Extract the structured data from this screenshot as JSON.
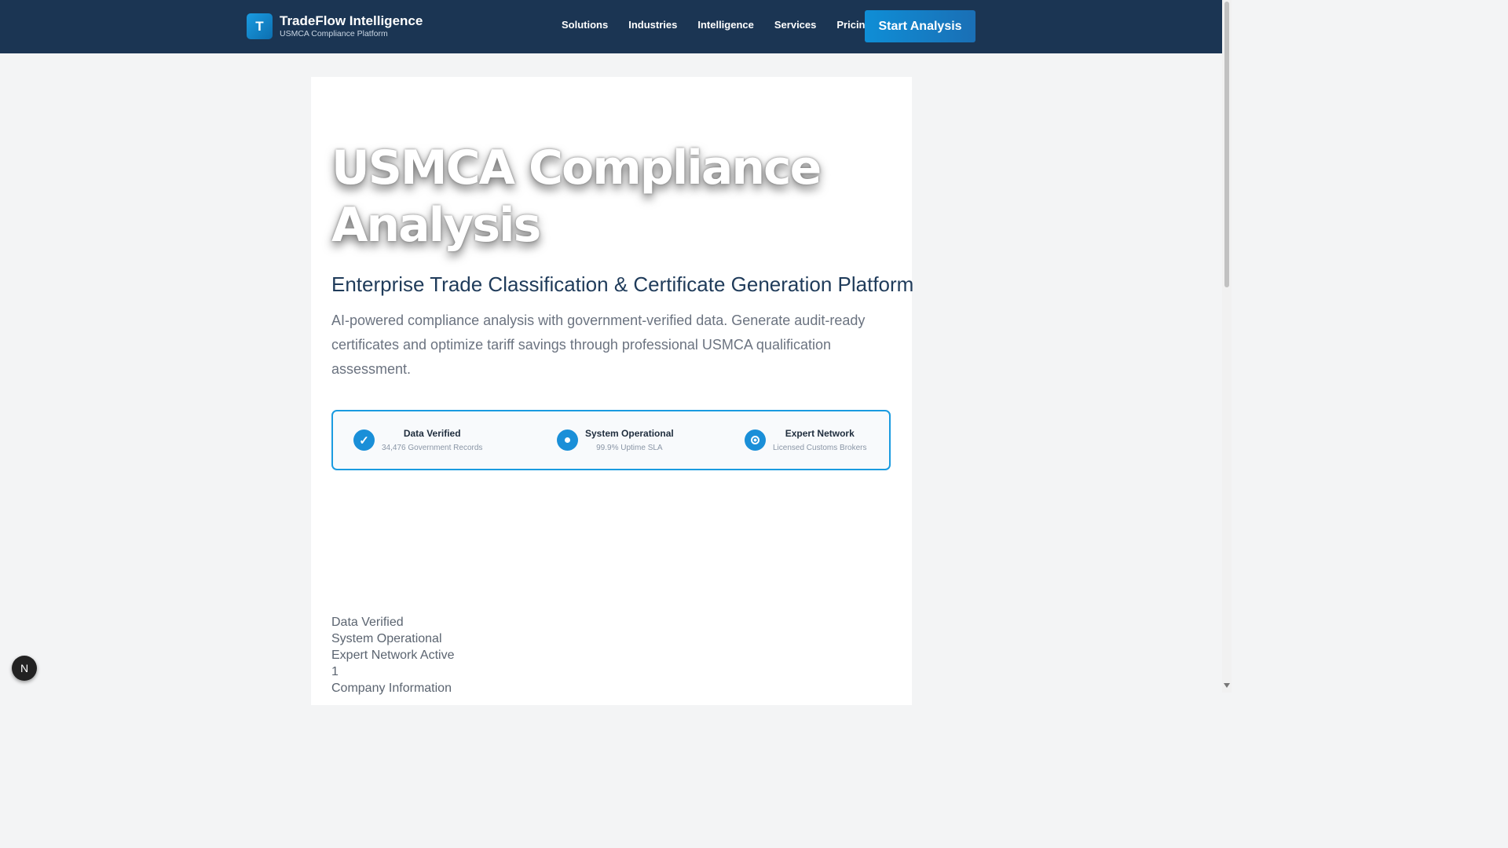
{
  "header": {
    "logo_letter": "T",
    "brand_name": "TradeFlow Intelligence",
    "tagline": "USMCA Compliance Platform",
    "nav": [
      "Solutions",
      "Industries",
      "Intelligence",
      "Services",
      "Pricing"
    ],
    "cta_label": "Start Analysis"
  },
  "hero": {
    "title": "USMCA Compliance Analysis",
    "subtitle": "Enterprise Trade Classification & Certificate Generation Platform",
    "description": "AI-powered compliance analysis with government-verified data. Generate audit-ready certificates and optimize tariff savings through professional USMCA qualification assessment."
  },
  "status": [
    {
      "icon": "check-icon",
      "title": "Data Verified",
      "meta": "34,476 Government Records"
    },
    {
      "icon": "dot-icon",
      "title": "System Operational",
      "meta": "99.9% Uptime SLA"
    },
    {
      "icon": "target-icon",
      "title": "Expert Network",
      "meta": "Licensed Customs Brokers"
    }
  ],
  "plain_list": [
    "Data Verified",
    "System Operational",
    "Expert Network Active",
    "1",
    "Company Information"
  ],
  "dev_badge": "N",
  "colors": {
    "navbar": "#1b3553",
    "accent": "#1a8fd8",
    "heading": "#1f3b5a"
  }
}
